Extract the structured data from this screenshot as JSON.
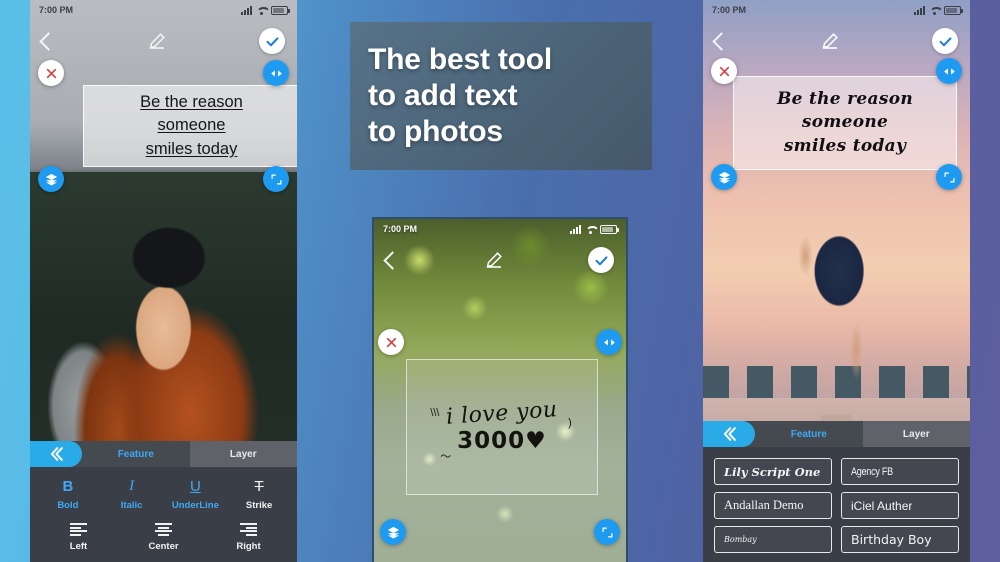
{
  "promo": {
    "headline_lines": [
      "The best tool",
      "to add text",
      "to photos"
    ]
  },
  "status_bar": {
    "time": "7:00 PM"
  },
  "phones": {
    "left": {
      "quote_lines": [
        "Be the reason ",
        "someone",
        "smiles today"
      ],
      "panel": {
        "tabs": [
          {
            "label": "Feature",
            "active": true
          },
          {
            "label": "Layer",
            "active": false
          }
        ],
        "style_tools": [
          {
            "glyph": "B",
            "label": "Bold"
          },
          {
            "glyph": "I",
            "label": "Italic"
          },
          {
            "glyph": "U",
            "label": "UnderLine"
          },
          {
            "glyph": "T",
            "label": "Strike"
          }
        ],
        "align_tools": [
          {
            "label": "Left"
          },
          {
            "label": "Center"
          },
          {
            "label": "Right"
          }
        ]
      }
    },
    "middle": {
      "overlay_line1": "i love you",
      "overlay_line2": "3000♥"
    },
    "right": {
      "quote_lines": [
        "Be the reason",
        "someone",
        "smiles today"
      ],
      "panel": {
        "tabs": [
          {
            "label": "Feature",
            "active": true
          },
          {
            "label": "Layer",
            "active": false
          }
        ],
        "fonts": [
          "Lily Script One",
          "Agency FB",
          "Andallan Demo",
          "iCiel Auther",
          "Bombay",
          "Birthday Boy"
        ]
      }
    }
  },
  "icons": {
    "back": "chevron-left-icon",
    "edit": "pencil-icon",
    "confirm": "check-icon",
    "close": "close-icon",
    "flip": "flip-horizontal-icon",
    "layers": "layers-icon",
    "resize": "resize-icon",
    "collapse": "double-chevron-left-icon"
  },
  "colors": {
    "accent_blue": "#3fa9f5",
    "fab_blue": "#1e9bf0",
    "panel_bg": "#3a3e46",
    "banner_bg": "#4c6478"
  }
}
